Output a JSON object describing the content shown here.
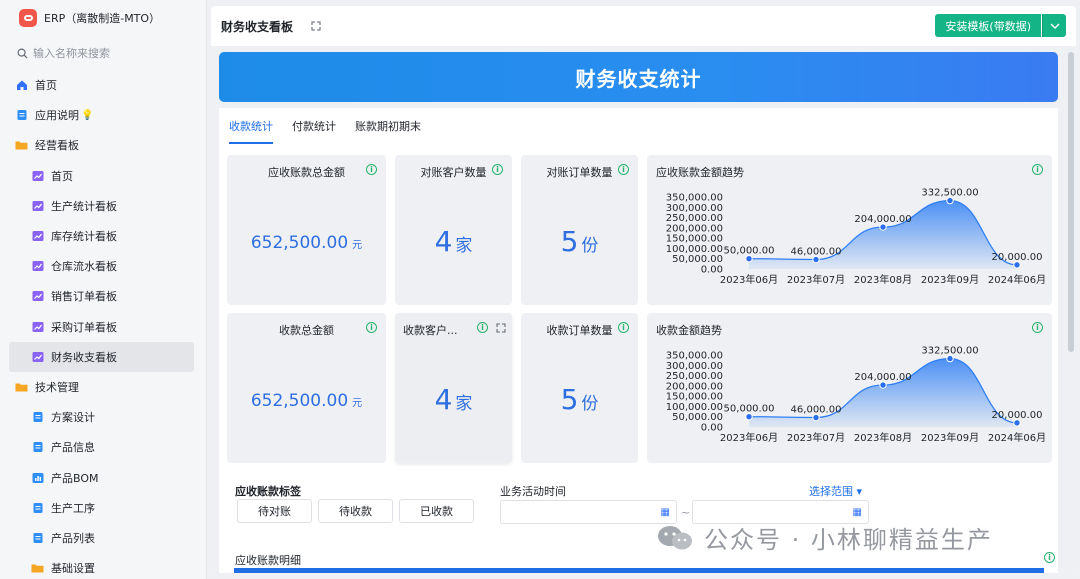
{
  "app": {
    "title": "ERP（离散制造-MTO）"
  },
  "search": {
    "placeholder": "输入名称来搜索"
  },
  "nav": [
    {
      "label": "首页",
      "icon": "home-icon",
      "level": 1
    },
    {
      "label": "应用说明",
      "icon": "doc-icon",
      "level": 1
    },
    {
      "label": "经营看板",
      "icon": "folder-icon",
      "level": 1
    },
    {
      "label": "首页",
      "icon": "dashboard-icon",
      "level": 2
    },
    {
      "label": "生产统计看板",
      "icon": "dashboard-icon",
      "level": 2
    },
    {
      "label": "库存统计看板",
      "icon": "dashboard-icon",
      "level": 2
    },
    {
      "label": "仓库流水看板",
      "icon": "dashboard-icon",
      "level": 2
    },
    {
      "label": "销售订单看板",
      "icon": "dashboard-icon",
      "level": 2
    },
    {
      "label": "采购订单看板",
      "icon": "dashboard-icon",
      "level": 2
    },
    {
      "label": "财务收支看板",
      "icon": "dashboard-icon",
      "level": 2,
      "active": true
    },
    {
      "label": "技术管理",
      "icon": "folder-icon",
      "level": 1
    },
    {
      "label": "方案设计",
      "icon": "doc-icon",
      "level": 2
    },
    {
      "label": "产品信息",
      "icon": "doc-icon",
      "level": 2
    },
    {
      "label": "产品BOM",
      "icon": "bom-icon",
      "level": 2
    },
    {
      "label": "生产工序",
      "icon": "doc-icon",
      "level": 2
    },
    {
      "label": "产品列表",
      "icon": "doc-icon",
      "level": 2
    },
    {
      "label": "基础设置",
      "icon": "folder-icon",
      "level": 2
    }
  ],
  "header": {
    "title": "财务收支看板",
    "install_label": "安装模板(带数据)"
  },
  "banner": {
    "title": "财务收支统计"
  },
  "tabs": [
    {
      "label": "收款统计",
      "active": true
    },
    {
      "label": "付款统计"
    },
    {
      "label": "账款期初期末"
    }
  ],
  "cards": {
    "receivable_total": {
      "title": "应收账款总金额",
      "value": "652,500.00",
      "unit": "元"
    },
    "recon_customers": {
      "title": "对账客户数量",
      "value": "4",
      "unit": "家"
    },
    "recon_orders": {
      "title": "对账订单数量",
      "value": "5",
      "unit": "份"
    },
    "receipt_total": {
      "title": "收款总金额",
      "value": "652,500.00",
      "unit": "元"
    },
    "receipt_customers": {
      "title": "收款客户...",
      "value": "4",
      "unit": "家"
    },
    "receipt_orders": {
      "title": "收款订单数量",
      "value": "5",
      "unit": "份"
    }
  },
  "chart_data": [
    {
      "type": "area",
      "title": "应收账款金额趋势",
      "categories": [
        "2023年06月",
        "2023年07月",
        "2023年08月",
        "2023年09月",
        "2024年06月"
      ],
      "values": [
        50000,
        46000,
        204000,
        332500,
        20000
      ],
      "value_labels": [
        "50,000.00",
        "46,000.00",
        "204,000.00",
        "332,500.00",
        "20,000.00"
      ],
      "y_ticks": [
        "0.00",
        "50,000.00",
        "100,000.00",
        "150,000.00",
        "200,000.00",
        "250,000.00",
        "300,000.00",
        "350,000.00"
      ],
      "ylim": [
        0,
        350000
      ],
      "color": "#2f7ff5"
    },
    {
      "type": "area",
      "title": "收款金额趋势",
      "categories": [
        "2023年06月",
        "2023年07月",
        "2023年08月",
        "2023年09月",
        "2024年06月"
      ],
      "values": [
        50000,
        46000,
        204000,
        332500,
        20000
      ],
      "value_labels": [
        "50,000.00",
        "46,000.00",
        "204,000.00",
        "332,500.00",
        "20,000.00"
      ],
      "y_ticks": [
        "0.00",
        "50,000.00",
        "100,000.00",
        "150,000.00",
        "200,000.00",
        "250,000.00",
        "300,000.00",
        "350,000.00"
      ],
      "ylim": [
        0,
        350000
      ],
      "color": "#2f7ff5"
    }
  ],
  "filters": {
    "tag_label": "应收账款标签",
    "tag_options": [
      "待对账",
      "待收款",
      "已收款"
    ],
    "time_label": "业务活动时间",
    "range_label": "选择范围",
    "separator": "~",
    "detail_label": "应收账款明细"
  },
  "watermark": {
    "text": "公众号 · 小林聊精益生产"
  }
}
